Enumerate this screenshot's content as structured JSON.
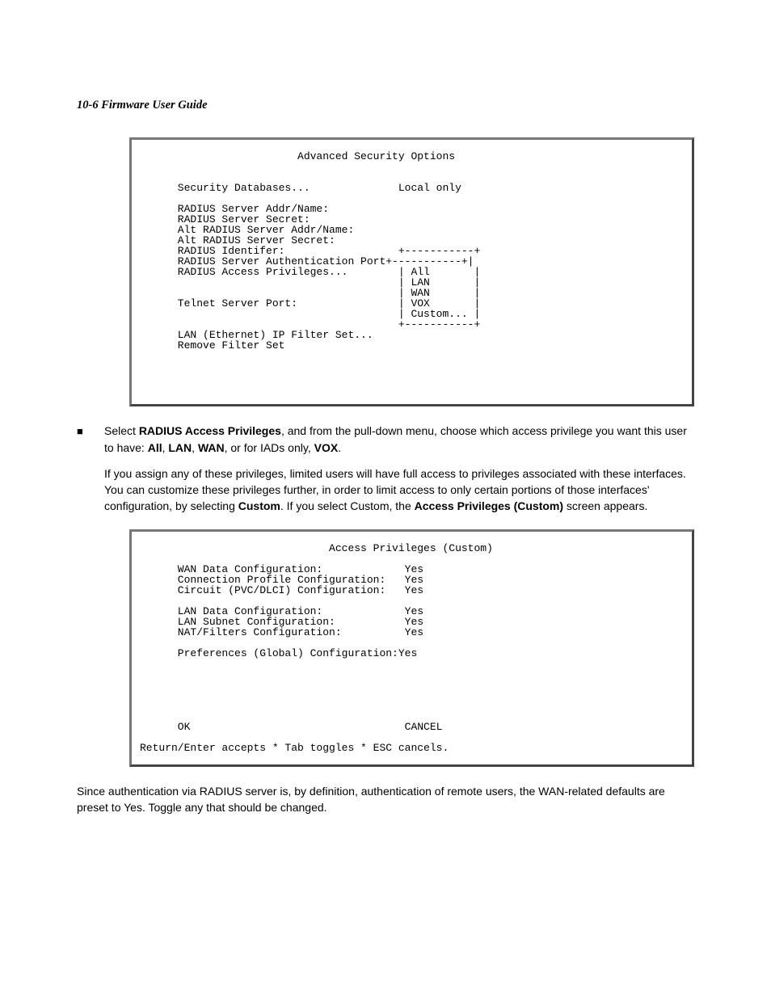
{
  "header": "10-6  Firmware User Guide",
  "terminal1": "                         Advanced Security Options\n\n\n      Security Databases...              Local only\n\n      RADIUS Server Addr/Name:\n      RADIUS Server Secret:\n      Alt RADIUS Server Addr/Name:\n      Alt RADIUS Server Secret:\n      RADIUS Identifer:                  +-----------+\n      RADIUS Server Authentication Port+-----------+|\n      RADIUS Access Privileges...        | All       |\n                                         | LAN       |\n                                         | WAN       |\n      Telnet Server Port:                | VOX       |\n                                         | Custom... |\n                                         +-----------+\n      LAN (Ethernet) IP Filter Set...\n      Remove Filter Set\n\n\n\n\n",
  "bullet": {
    "mark": "■",
    "t1": "Select ",
    "b1": "RADIUS Access Privileges",
    "t2": ", and from the pull-down menu, choose which access privilege you want this user to have: ",
    "b2": "All",
    "sep": ", ",
    "b3": "LAN",
    "b4": "WAN",
    "t3": ", or for IADs only, ",
    "b5": "VOX",
    "dot": "."
  },
  "para1": {
    "t1": "If you assign any of these privileges, limited users will have full access to privileges associated with these interfaces. You can customize these privileges further, in order to limit access to only certain portions of those interfaces' configuration, by selecting ",
    "b1": "Custom",
    "t2": ". If you select Custom, the ",
    "b2": "Access Privileges (Custom)",
    "t3": " screen appears."
  },
  "terminal2": "                              Access Privileges (Custom)\n\n      WAN Data Configuration:             Yes\n      Connection Profile Configuration:   Yes\n      Circuit (PVC/DLCI) Configuration:   Yes\n\n      LAN Data Configuration:             Yes\n      LAN Subnet Configuration:           Yes\n      NAT/Filters Configuration:          Yes\n\n      Preferences (Global) Configuration:Yes\n\n\n\n\n\n\n      OK                                  CANCEL\n\nReturn/Enter accepts * Tab toggles * ESC cancels.\n",
  "para2": "Since authentication via RADIUS server is, by definition, authentication of remote users, the WAN-related defaults are preset to Yes. Toggle any that should be changed.",
  "chart_data": {
    "type": "table",
    "title": "Access Privileges (Custom)",
    "rows": [
      {
        "label": "WAN Data Configuration",
        "value": "Yes"
      },
      {
        "label": "Connection Profile Configuration",
        "value": "Yes"
      },
      {
        "label": "Circuit (PVC/DLCI) Configuration",
        "value": "Yes"
      },
      {
        "label": "LAN Data Configuration",
        "value": "Yes"
      },
      {
        "label": "LAN Subnet Configuration",
        "value": "Yes"
      },
      {
        "label": "NAT/Filters Configuration",
        "value": "Yes"
      },
      {
        "label": "Preferences (Global) Configuration",
        "value": "Yes"
      }
    ],
    "actions": [
      "OK",
      "CANCEL"
    ],
    "footer": "Return/Enter accepts * Tab toggles * ESC cancels."
  }
}
